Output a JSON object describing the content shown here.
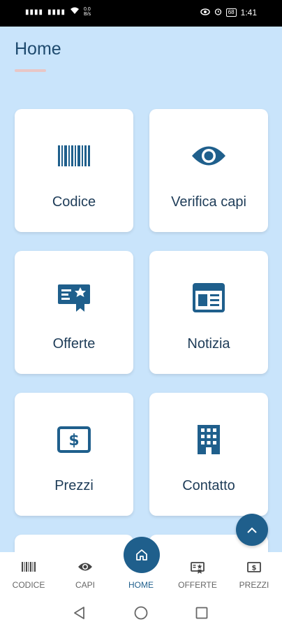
{
  "status": {
    "time": "1:41",
    "speed": "0.0\nB/s",
    "battery": "68"
  },
  "page": {
    "title": "Home"
  },
  "cards": [
    {
      "label": "Codice",
      "icon": "barcode-icon"
    },
    {
      "label": "Verifica capi",
      "icon": "eye-icon"
    },
    {
      "label": "Offerte",
      "icon": "certificate-icon"
    },
    {
      "label": "Notizia",
      "icon": "newspaper-icon"
    },
    {
      "label": "Prezzi",
      "icon": "money-bill-icon"
    },
    {
      "label": "Contatto",
      "icon": "building-icon"
    }
  ],
  "nav": [
    {
      "label": "CODICE",
      "icon": "barcode-icon"
    },
    {
      "label": "CAPI",
      "icon": "eye-icon"
    },
    {
      "label": "HOME",
      "icon": "home-icon"
    },
    {
      "label": "OFFERTE",
      "icon": "certificate-icon"
    },
    {
      "label": "PREZZI",
      "icon": "money-bill-icon"
    }
  ],
  "colors": {
    "primary": "#1f5f8c",
    "background": "#c9e4fb",
    "text": "#1e3c58"
  }
}
